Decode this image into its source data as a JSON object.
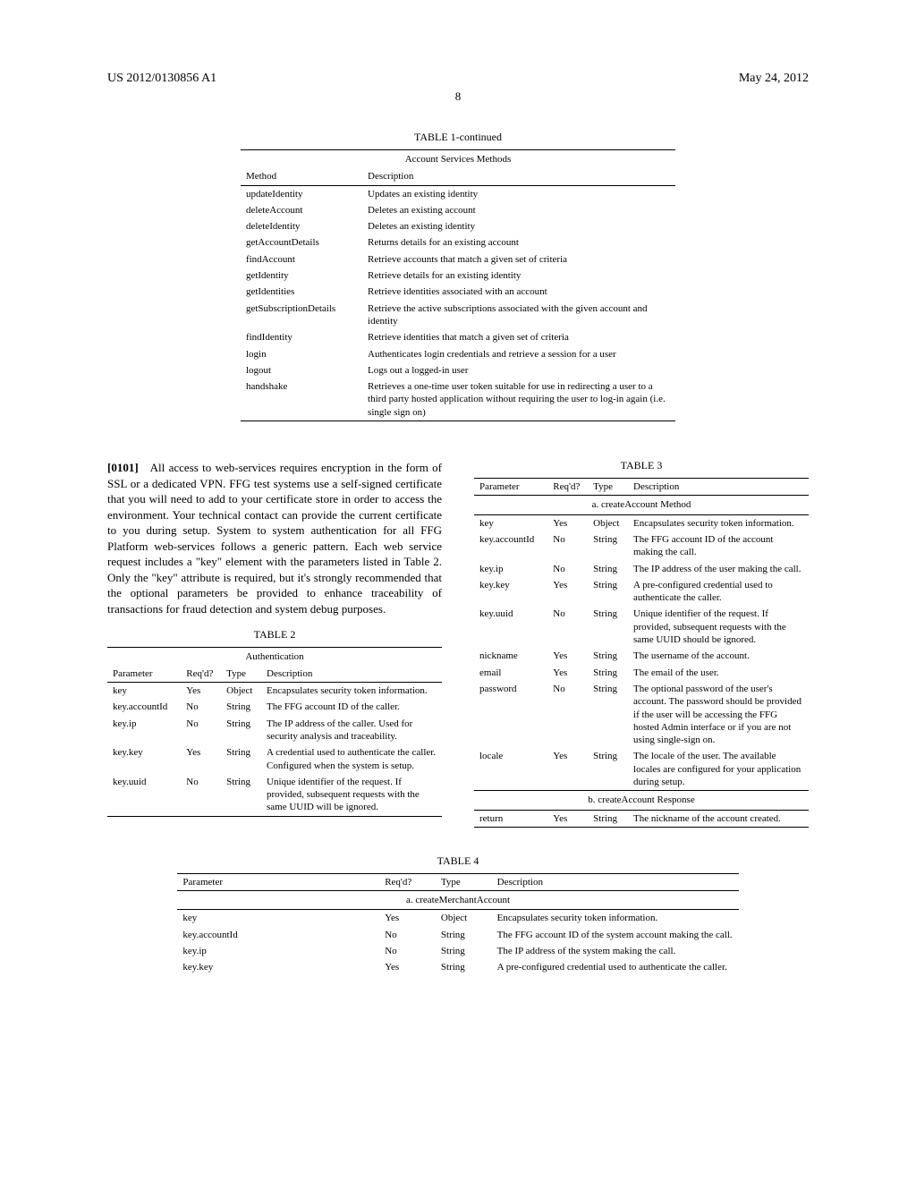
{
  "header": {
    "left": "US 2012/0130856 A1",
    "right": "May 24, 2012",
    "page": "8"
  },
  "table1": {
    "title": "TABLE 1-continued",
    "subtitle": "Account Services Methods",
    "head": {
      "c1": "Method",
      "c2": "Description"
    },
    "rows": [
      {
        "c1": "updateIdentity",
        "c2": "Updates an existing identity"
      },
      {
        "c1": "deleteAccount",
        "c2": "Deletes an existing account"
      },
      {
        "c1": "deleteIdentity",
        "c2": "Deletes an existing identity"
      },
      {
        "c1": "getAccountDetails",
        "c2": "Returns details for an existing account"
      },
      {
        "c1": "findAccount",
        "c2": "Retrieve accounts that match a given set of criteria"
      },
      {
        "c1": "getIdentity",
        "c2": "Retrieve details for an existing identity"
      },
      {
        "c1": "getIdentities",
        "c2": "Retrieve identities associated with an account"
      },
      {
        "c1": "getSubscriptionDetails",
        "c2": "Retrieve the active subscriptions associated with the given account and identity"
      },
      {
        "c1": "findIdentity",
        "c2": "Retrieve identities that match a given set of criteria"
      },
      {
        "c1": "login",
        "c2": "Authenticates login credentials and retrieve a session for a user"
      },
      {
        "c1": "logout",
        "c2": "Logs out a logged-in user"
      },
      {
        "c1": "handshake",
        "c2": "Retrieves a one-time user token suitable for use in redirecting a user to a third party hosted application without requiring the user to log-in again (i.e. single sign on)"
      }
    ]
  },
  "para101": {
    "num": "[0101]",
    "text": "All access to web-services requires encryption in the form of SSL or a dedicated VPN. FFG test systems use a self-signed certificate that you will need to add to your certificate store in order to access the environment. Your technical contact can provide the current certificate to you during setup. System to system authentication for all FFG Platform web-services follows a generic pattern. Each web service request includes a \"key\" element with the parameters listed in Table 2. Only the \"key\" attribute is required, but it's strongly recommended that the optional parameters be provided to enhance traceability of transactions for fraud detection and system debug purposes."
  },
  "table2": {
    "title": "TABLE 2",
    "subtitle": "Authentication",
    "head": {
      "c1": "Parameter",
      "c2": "Req'd?",
      "c3": "Type",
      "c4": "Description"
    },
    "rows": [
      {
        "c1": "key",
        "c2": "Yes",
        "c3": "Object",
        "c4": "Encapsulates security token information."
      },
      {
        "c1": "key.accountId",
        "c2": "No",
        "c3": "String",
        "c4": "The FFG account ID of the caller."
      },
      {
        "c1": "key.ip",
        "c2": "No",
        "c3": "String",
        "c4": "The IP address of the caller. Used for security analysis and traceability."
      },
      {
        "c1": "key.key",
        "c2": "Yes",
        "c3": "String",
        "c4": "A credential used to authenticate the caller. Configured when the system is setup."
      },
      {
        "c1": "key.uuid",
        "c2": "No",
        "c3": "String",
        "c4": "Unique identifier of the request. If provided, subsequent requests with the same UUID will be ignored."
      }
    ]
  },
  "table3": {
    "title": "TABLE 3",
    "head": {
      "c1": "Parameter",
      "c2": "Req'd?",
      "c3": "Type",
      "c4": "Description"
    },
    "sectionA": "a. createAccount Method",
    "rowsA": [
      {
        "c1": "key",
        "c2": "Yes",
        "c3": "Object",
        "c4": "Encapsulates security token information."
      },
      {
        "c1": "key.accountId",
        "c2": "No",
        "c3": "String",
        "c4": "The FFG account ID of the account making the call."
      },
      {
        "c1": "key.ip",
        "c2": "No",
        "c3": "String",
        "c4": "The IP address of the user making the call."
      },
      {
        "c1": "key.key",
        "c2": "Yes",
        "c3": "String",
        "c4": "A pre-configured credential used to authenticate the caller."
      },
      {
        "c1": "key.uuid",
        "c2": "No",
        "c3": "String",
        "c4": "Unique identifier of the request. If provided, subsequent requests with the same UUID should be ignored."
      },
      {
        "c1": "nickname",
        "c2": "Yes",
        "c3": "String",
        "c4": "The username of the account."
      },
      {
        "c1": "email",
        "c2": "Yes",
        "c3": "String",
        "c4": "The email of the user."
      },
      {
        "c1": "password",
        "c2": "No",
        "c3": "String",
        "c4": "The optional password of the user's account. The password should be provided if the user will be accessing the FFG hosted Admin interface or if you are not using single-sign on."
      },
      {
        "c1": "locale",
        "c2": "Yes",
        "c3": "String",
        "c4": "The locale of the user. The available locales are configured for your application during setup."
      }
    ],
    "sectionB": "b. createAccount Response",
    "rowsB": [
      {
        "c1": "return",
        "c2": "Yes",
        "c3": "String",
        "c4": "The nickname of the account created."
      }
    ]
  },
  "table4": {
    "title": "TABLE 4",
    "head": {
      "c1": "Parameter",
      "c2": "Req'd?",
      "c3": "Type",
      "c4": "Description"
    },
    "sectionA": "a. createMerchantAccount",
    "rows": [
      {
        "c1": "key",
        "c2": "Yes",
        "c3": "Object",
        "c4": "Encapsulates security token information."
      },
      {
        "c1": "key.accountId",
        "c2": "No",
        "c3": "String",
        "c4": "The FFG account ID of the system account making the call."
      },
      {
        "c1": "key.ip",
        "c2": "No",
        "c3": "String",
        "c4": "The IP address of the system making the call."
      },
      {
        "c1": "key.key",
        "c2": "Yes",
        "c3": "String",
        "c4": "A pre-configured credential used to authenticate the caller."
      }
    ]
  }
}
